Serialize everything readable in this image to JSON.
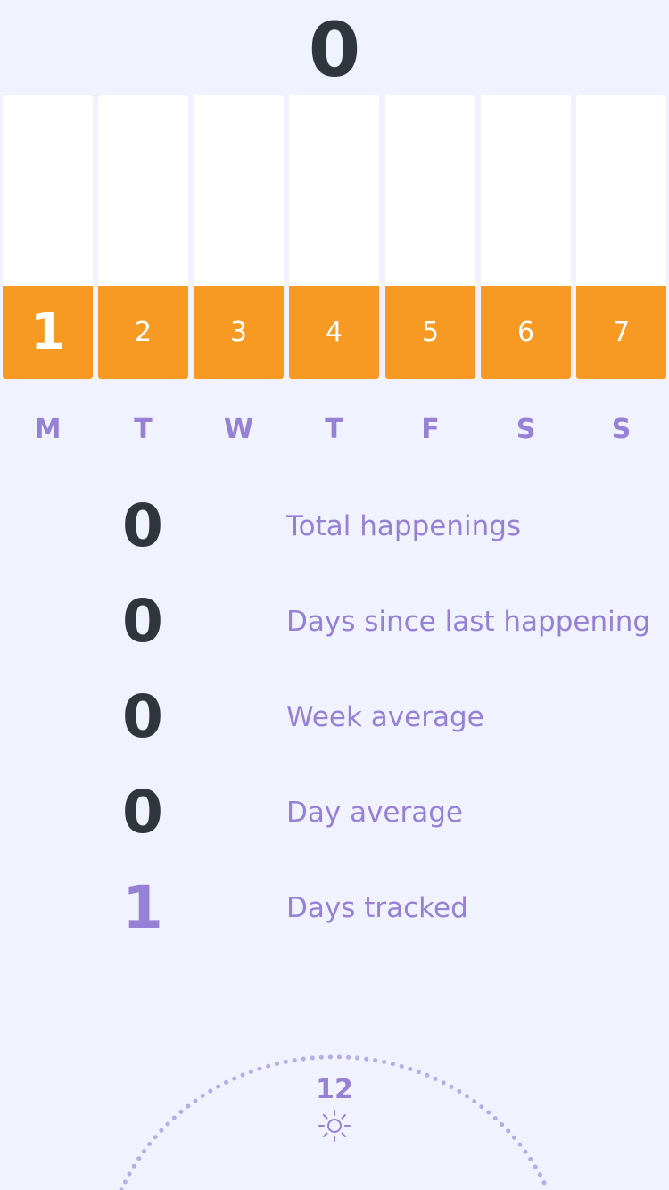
{
  "header": {
    "count": "0"
  },
  "week": {
    "days": [
      {
        "number": "1",
        "weekday": "M",
        "today": true
      },
      {
        "number": "2",
        "weekday": "T",
        "today": false
      },
      {
        "number": "3",
        "weekday": "W",
        "today": false
      },
      {
        "number": "4",
        "weekday": "T",
        "today": false
      },
      {
        "number": "5",
        "weekday": "F",
        "today": false
      },
      {
        "number": "6",
        "weekday": "S",
        "today": false
      },
      {
        "number": "7",
        "weekday": "S",
        "today": false
      }
    ]
  },
  "stats": [
    {
      "value": "0",
      "label": "Total happenings"
    },
    {
      "value": "0",
      "label": "Days since last happening"
    },
    {
      "value": "0",
      "label": "Week average"
    },
    {
      "value": "0",
      "label": "Day average"
    },
    {
      "value": "1",
      "label": "Days tracked"
    }
  ],
  "clock": {
    "hour_label": "12",
    "icon": "sun-icon"
  },
  "colors": {
    "background": "#f0f2fd",
    "accent_orange": "#f79a24",
    "accent_purple": "#9781d5",
    "text_dark": "#2f373d"
  }
}
